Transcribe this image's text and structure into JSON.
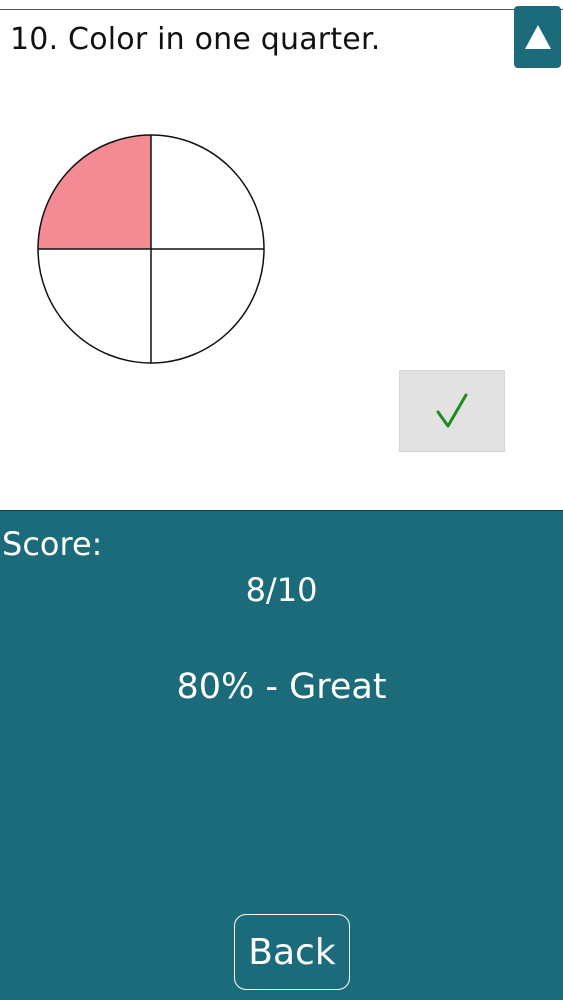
{
  "question": {
    "text": "10. Color in one quarter."
  },
  "header": {
    "collapse_icon": "triangle-up-icon"
  },
  "fraction_circle": {
    "quarters": [
      {
        "position": "top-left",
        "filled": true
      },
      {
        "position": "top-right",
        "filled": false
      },
      {
        "position": "bottom-left",
        "filled": false
      },
      {
        "position": "bottom-right",
        "filled": false
      }
    ]
  },
  "check": {
    "icon": "checkmark-icon",
    "glyph": "✓"
  },
  "score": {
    "label": "Score:",
    "value": "8/10",
    "rating": "80% - Great"
  },
  "back_button": {
    "label": "Back"
  },
  "colors": {
    "accent": "#1b6b7b",
    "fill": "#f48a93",
    "check": "#1e8c1e",
    "button_bg": "#e2e2e2"
  }
}
